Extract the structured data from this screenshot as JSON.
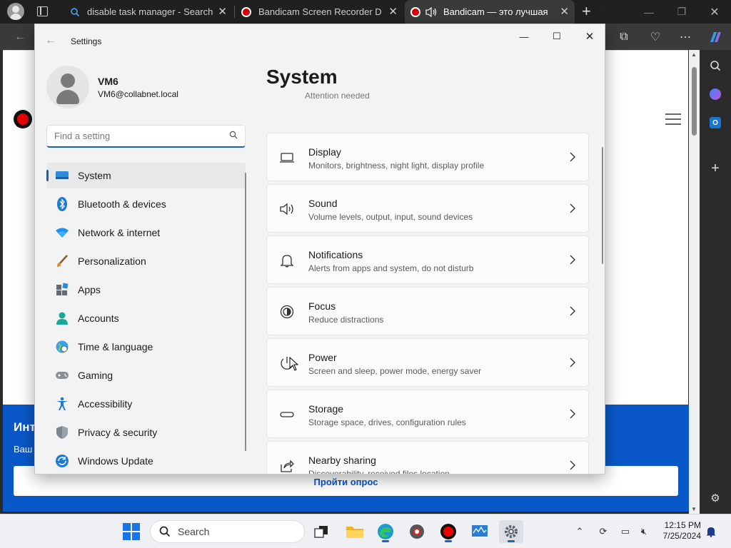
{
  "browser": {
    "tabs": [
      {
        "title": "disable task manager - Search",
        "icon": "search-icon"
      },
      {
        "title": "Bandicam Screen Recorder Dow",
        "icon": "bandicam-icon"
      },
      {
        "title": "Bandicam — это лучшая пр",
        "icon": "bandicam-icon",
        "active": true
      }
    ],
    "new_tab_label": "+",
    "page": {
      "banner_title": "Инт",
      "banner_sub": "Ваш",
      "survey_button": "Пройти опрос"
    }
  },
  "settings": {
    "app_title": "Settings",
    "user": {
      "name": "VM6",
      "email": "VM6@collabnet.local"
    },
    "search_placeholder": "Find a setting",
    "page_title": "System",
    "attention_text": "Attention needed",
    "nav": [
      {
        "label": "System",
        "icon": "system-icon",
        "selected": true
      },
      {
        "label": "Bluetooth & devices",
        "icon": "bluetooth-icon"
      },
      {
        "label": "Network & internet",
        "icon": "network-icon"
      },
      {
        "label": "Personalization",
        "icon": "personalization-icon"
      },
      {
        "label": "Apps",
        "icon": "apps-icon"
      },
      {
        "label": "Accounts",
        "icon": "accounts-icon"
      },
      {
        "label": "Time & language",
        "icon": "time-language-icon"
      },
      {
        "label": "Gaming",
        "icon": "gaming-icon"
      },
      {
        "label": "Accessibility",
        "icon": "accessibility-icon"
      },
      {
        "label": "Privacy & security",
        "icon": "privacy-icon"
      },
      {
        "label": "Windows Update",
        "icon": "windows-update-icon"
      }
    ],
    "cards": [
      {
        "title": "Display",
        "desc": "Monitors, brightness, night light, display profile",
        "icon": "display-icon"
      },
      {
        "title": "Sound",
        "desc": "Volume levels, output, input, sound devices",
        "icon": "sound-icon"
      },
      {
        "title": "Notifications",
        "desc": "Alerts from apps and system, do not disturb",
        "icon": "notifications-icon"
      },
      {
        "title": "Focus",
        "desc": "Reduce distractions",
        "icon": "focus-icon"
      },
      {
        "title": "Power",
        "desc": "Screen and sleep, power mode, energy saver",
        "icon": "power-icon"
      },
      {
        "title": "Storage",
        "desc": "Storage space, drives, configuration rules",
        "icon": "storage-icon"
      },
      {
        "title": "Nearby sharing",
        "desc": "Discoverability, received files location",
        "icon": "nearby-sharing-icon"
      }
    ]
  },
  "taskbar": {
    "search_label": "Search",
    "time": "12:15 PM",
    "date": "7/25/2024"
  },
  "colors": {
    "accent": "#1a62b4",
    "banner_blue": "#0a58c8",
    "record_red": "#d80000"
  }
}
